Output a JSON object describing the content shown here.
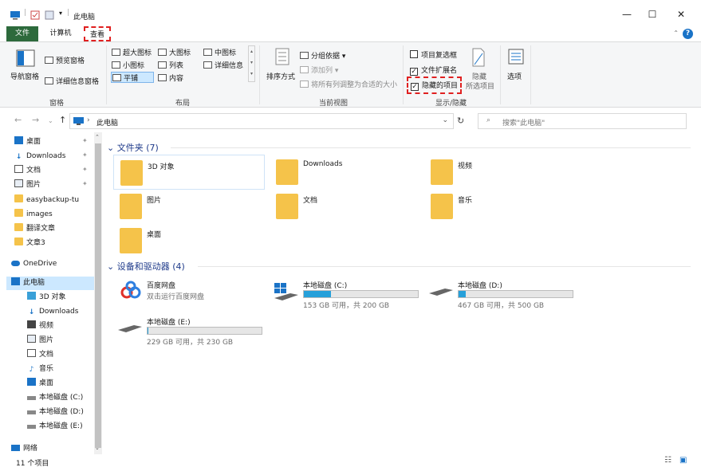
{
  "window": {
    "title": "此电脑",
    "minimize": "—",
    "maximize": "☐",
    "close": "✕"
  },
  "tabs": {
    "file": "文件",
    "computer": "计算机",
    "view": "查看"
  },
  "ribbon": {
    "panes": {
      "nav_pane": "导航窗格",
      "preview_pane": "预览窗格",
      "details_pane": "详细信息窗格",
      "group": "窗格"
    },
    "layout": {
      "xl_icons": "超大图标",
      "large_icons": "大图标",
      "medium_icons": "中图标",
      "small_icons": "小图标",
      "list": "列表",
      "details": "详细信息",
      "tiles": "平铺",
      "content": "内容",
      "group": "布局"
    },
    "current_view": {
      "sort_by": "排序方式",
      "group_by": "分组依据",
      "add_columns": "添加列",
      "size_all_columns": "将所有列调整为合适的大小",
      "group": "当前视图"
    },
    "show_hide": {
      "item_checkboxes": "项目复选框",
      "file_extensions": "文件扩展名",
      "hidden_items": "隐藏的项目",
      "hide_selected": "隐藏",
      "hide_selected2": "所选项目",
      "options": "选项",
      "group": "显示/隐藏",
      "item_checkboxes_checked": false,
      "file_extensions_checked": true,
      "hidden_items_checked": true
    }
  },
  "address": {
    "path": "此电脑",
    "search_placeholder": "搜索\"此电脑\""
  },
  "sidebar": {
    "items": [
      {
        "label": "桌面"
      },
      {
        "label": "Downloads"
      },
      {
        "label": "文档"
      },
      {
        "label": "图片"
      },
      {
        "label": "easybackup-tu"
      },
      {
        "label": "images"
      },
      {
        "label": "翻译文章"
      },
      {
        "label": "文章3"
      },
      {
        "label": "OneDrive"
      },
      {
        "label": "此电脑"
      },
      {
        "label": "3D 对象"
      },
      {
        "label": "Downloads"
      },
      {
        "label": "视频"
      },
      {
        "label": "图片"
      },
      {
        "label": "文档"
      },
      {
        "label": "音乐"
      },
      {
        "label": "桌面"
      },
      {
        "label": "本地磁盘 (C:)"
      },
      {
        "label": "本地磁盘 (D:)"
      },
      {
        "label": "本地磁盘 (E:)"
      },
      {
        "label": "网络"
      }
    ]
  },
  "main": {
    "folders_header": "文件夹 (7)",
    "folders": [
      {
        "name": "3D 对象"
      },
      {
        "name": "Downloads"
      },
      {
        "name": "视频"
      },
      {
        "name": "图片"
      },
      {
        "name": "文档"
      },
      {
        "name": "音乐"
      },
      {
        "name": "桌面"
      }
    ],
    "devices_header": "设备和驱动器 (4)",
    "baidu": {
      "name": "百度网盘",
      "sub": "双击运行百度网盘"
    },
    "drives": [
      {
        "name": "本地磁盘 (C:)",
        "info": "153 GB 可用，共 200 GB",
        "used_fraction": 0.235
      },
      {
        "name": "本地磁盘 (D:)",
        "info": "467 GB 可用，共 500 GB",
        "used_fraction": 0.066
      },
      {
        "name": "本地磁盘 (E:)",
        "info": "229 GB 可用，共 230 GB",
        "used_fraction": 0.004
      }
    ]
  },
  "status": {
    "count": "11 个项目"
  },
  "colors": {
    "accent": "#1a73c7",
    "file_tab": "#2d6a3c",
    "folder": "#f5c34a",
    "drive_fill": "#26a0da",
    "highlight": "#e02020"
  }
}
